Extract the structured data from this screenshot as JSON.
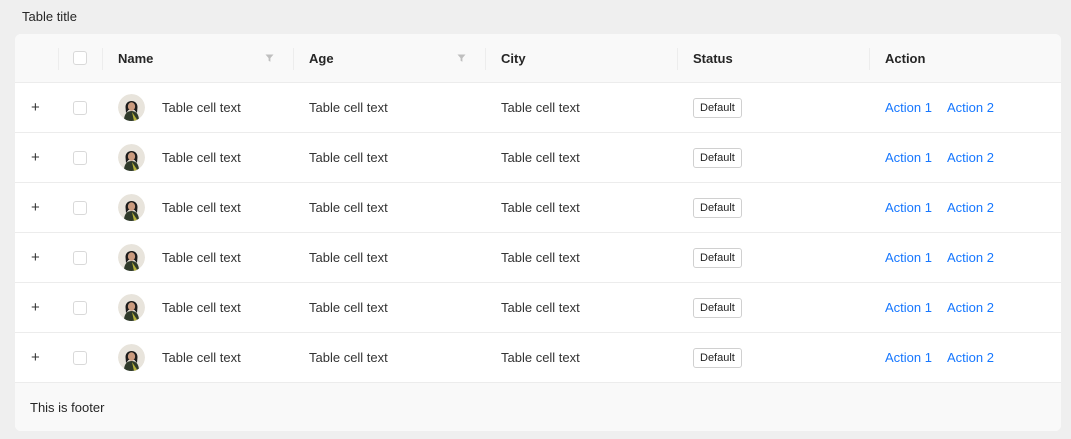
{
  "title": "Table title",
  "columns": {
    "name": "Name",
    "age": "Age",
    "city": "City",
    "status": "Status",
    "action": "Action"
  },
  "rows": [
    {
      "name": "Table cell text",
      "age": "Table cell text",
      "city": "Table cell text",
      "status": "Default",
      "action1": "Action 1",
      "action2": "Action 2"
    },
    {
      "name": "Table cell text",
      "age": "Table cell text",
      "city": "Table cell text",
      "status": "Default",
      "action1": "Action 1",
      "action2": "Action 2"
    },
    {
      "name": "Table cell text",
      "age": "Table cell text",
      "city": "Table cell text",
      "status": "Default",
      "action1": "Action 1",
      "action2": "Action 2"
    },
    {
      "name": "Table cell text",
      "age": "Table cell text",
      "city": "Table cell text",
      "status": "Default",
      "action1": "Action 1",
      "action2": "Action 2"
    },
    {
      "name": "Table cell text",
      "age": "Table cell text",
      "city": "Table cell text",
      "status": "Default",
      "action1": "Action 1",
      "action2": "Action 2"
    },
    {
      "name": "Table cell text",
      "age": "Table cell text",
      "city": "Table cell text",
      "status": "Default",
      "action1": "Action 1",
      "action2": "Action 2"
    }
  ],
  "footer": "This is footer",
  "icons": {
    "expand": "plus-icon",
    "filter": "filter-icon",
    "avatar": "avatar"
  },
  "colors": {
    "link": "#1677ff",
    "header_bg": "#f9f9f9",
    "page_bg": "#efefef"
  }
}
